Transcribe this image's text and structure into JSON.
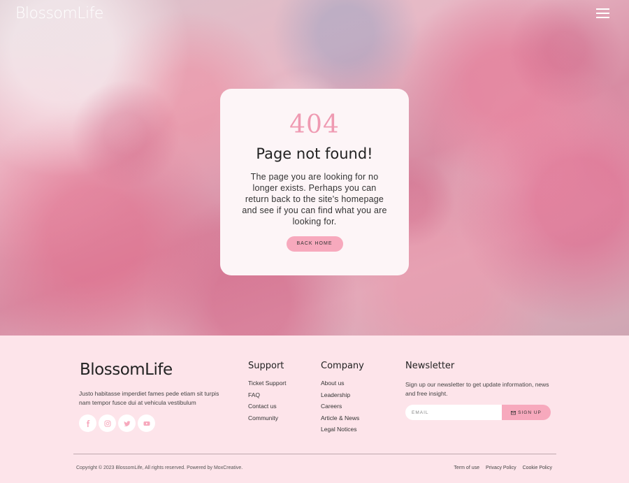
{
  "header": {
    "logo": "BlossomLife",
    "menu_icon": "hamburger-menu-icon"
  },
  "error": {
    "code": "404",
    "title": "Page not found!",
    "message": "The page you are looking for no longer exists. Perhaps you can return back to the site's homepage and see if you can find what you are looking for.",
    "button": "BACK HOME"
  },
  "footer": {
    "logo": "BlossomLife",
    "description": "Justo habitasse imperdiet fames pede etiam sit turpis nam tempor fusce dui at vehicula vestibulum",
    "socials": [
      "facebook-icon",
      "instagram-icon",
      "twitter-icon",
      "youtube-icon"
    ],
    "support": {
      "heading": "Support",
      "links": [
        "Ticket Support",
        "FAQ",
        "Contact us",
        "Community"
      ]
    },
    "company": {
      "heading": "Company",
      "links": [
        "About us",
        "Leadership",
        "Careers",
        "Article & News",
        "Legal Notices"
      ]
    },
    "newsletter": {
      "heading": "Newsletter",
      "text": "Sign up our newsletter to get update information, news and free insight.",
      "email_placeholder": "EMAIL",
      "button": "SIGN UP"
    },
    "copyright": "Copyright © 2023 BlossomLife, All rights reserved. Powered by MoxCreative.",
    "legal": [
      "Term of use",
      "Privacy Policy",
      "Cookie Policy"
    ]
  },
  "colors": {
    "accent": "#f7a9bd",
    "code": "#ef9ab2",
    "footer_bg": "#fde4ea"
  }
}
